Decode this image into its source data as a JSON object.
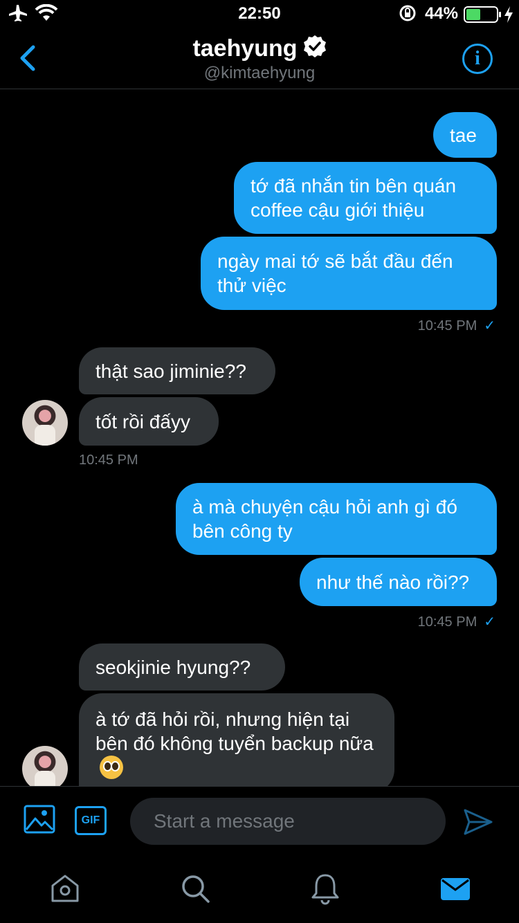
{
  "status": {
    "time": "22:50",
    "battery": "44%"
  },
  "header": {
    "name": "taehyung",
    "handle": "@kimtaehyung"
  },
  "messages": [
    {
      "dir": "out",
      "text": "tae"
    },
    {
      "dir": "out",
      "text": "tớ đã nhắn tin bên quán coffee cậu giới thiệu"
    },
    {
      "dir": "out",
      "text": "ngày mai tớ sẽ bắt đầu đến thử việc"
    },
    {
      "dir": "meta",
      "text": "10:45 PM"
    },
    {
      "dir": "in",
      "text": "thật sao jiminie??"
    },
    {
      "dir": "in",
      "text": "tốt rồi đấyy"
    },
    {
      "dir": "meta",
      "text": "10:45 PM"
    },
    {
      "dir": "out",
      "text": "à mà chuyện cậu hỏi anh gì đó bên công ty"
    },
    {
      "dir": "out",
      "text": "như thế nào rồi??"
    },
    {
      "dir": "meta",
      "text": "10:45 PM"
    },
    {
      "dir": "in",
      "text": "seokjinie hyung??"
    },
    {
      "dir": "in",
      "text": "à tớ đã hỏi rồi, nhưng hiện tại bên đó không tuyển backup nữa"
    }
  ],
  "composer": {
    "placeholder": "Start a message",
    "gif_label": "GIF"
  },
  "icons": [
    "airplane-icon",
    "wifi-icon",
    "rotation-lock-icon",
    "battery-icon",
    "charging-icon",
    "back-chevron-icon",
    "verified-badge-icon",
    "info-icon",
    "image-icon",
    "gif-icon",
    "send-icon",
    "home-icon",
    "search-icon",
    "notifications-icon",
    "messages-icon"
  ],
  "colors": {
    "accent": "#1da1f2",
    "background": "#000000",
    "incoming_bubble": "#2f3336",
    "muted_text": "#71767b",
    "battery": "#4cd964"
  }
}
